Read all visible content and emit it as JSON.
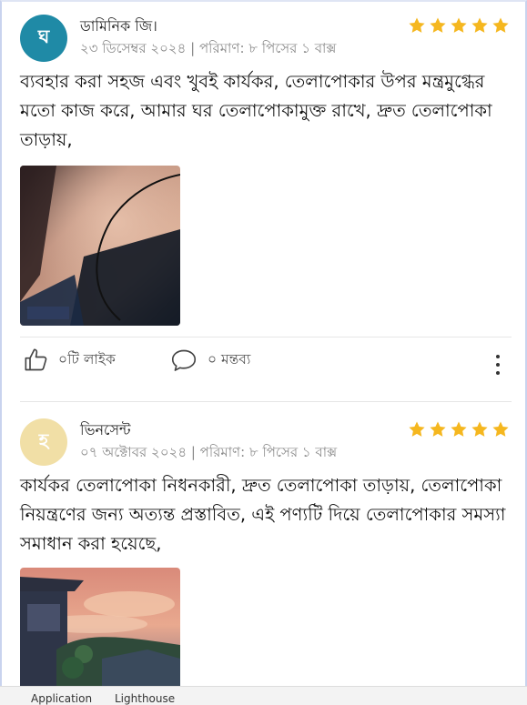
{
  "reviews": [
    {
      "avatar_letter": "ঘ",
      "avatar_color": "#1f8aa6",
      "name": "ডামিনিক জি।",
      "meta": "২৩ ডিসেম্বর ২০২৪ | পরিমাণ: ৮ পিসের ১ বাক্স",
      "rating": 5,
      "text": "ব্যবহার করা সহজ এবং খুবই কার্যকর, তেলাপোকার উপর মন্ত্রমুগ্ধের মতো কাজ করে, আমার ঘর তেলাপোকামুক্ত রাখে, দ্রুত তেলাপোকা তাড়ায়,",
      "photo_icon": "review-photo"
    },
    {
      "avatar_letter": "হ",
      "avatar_color": "#f1dfa6",
      "name": "ভিনসেন্ট",
      "meta": "০৭ অক্টোবর ২০২৪ | পরিমাণ: ৮ পিসের ১ বাক্স",
      "rating": 5,
      "text": "কার্যকর তেলাপোকা নিধনকারী, দ্রুত তেলাপোকা তাড়ায়, তেলাপোকা নিয়ন্ত্রণের জন্য অত্যন্ত প্রস্তাবিত, এই পণ্যটি দিয়ে তেলাপোকার সমস্যা সমাধান করা হয়েছে,",
      "photo_icon": "review-photo"
    }
  ],
  "actions": {
    "like_label": "০টি লাইক",
    "comment_label": "০ মন্তব্য"
  },
  "colors": {
    "star": "#f5b71f",
    "accent_teal": "#1f8aa6"
  },
  "devtools": {
    "tabs": [
      "Application",
      "Lighthouse"
    ]
  }
}
